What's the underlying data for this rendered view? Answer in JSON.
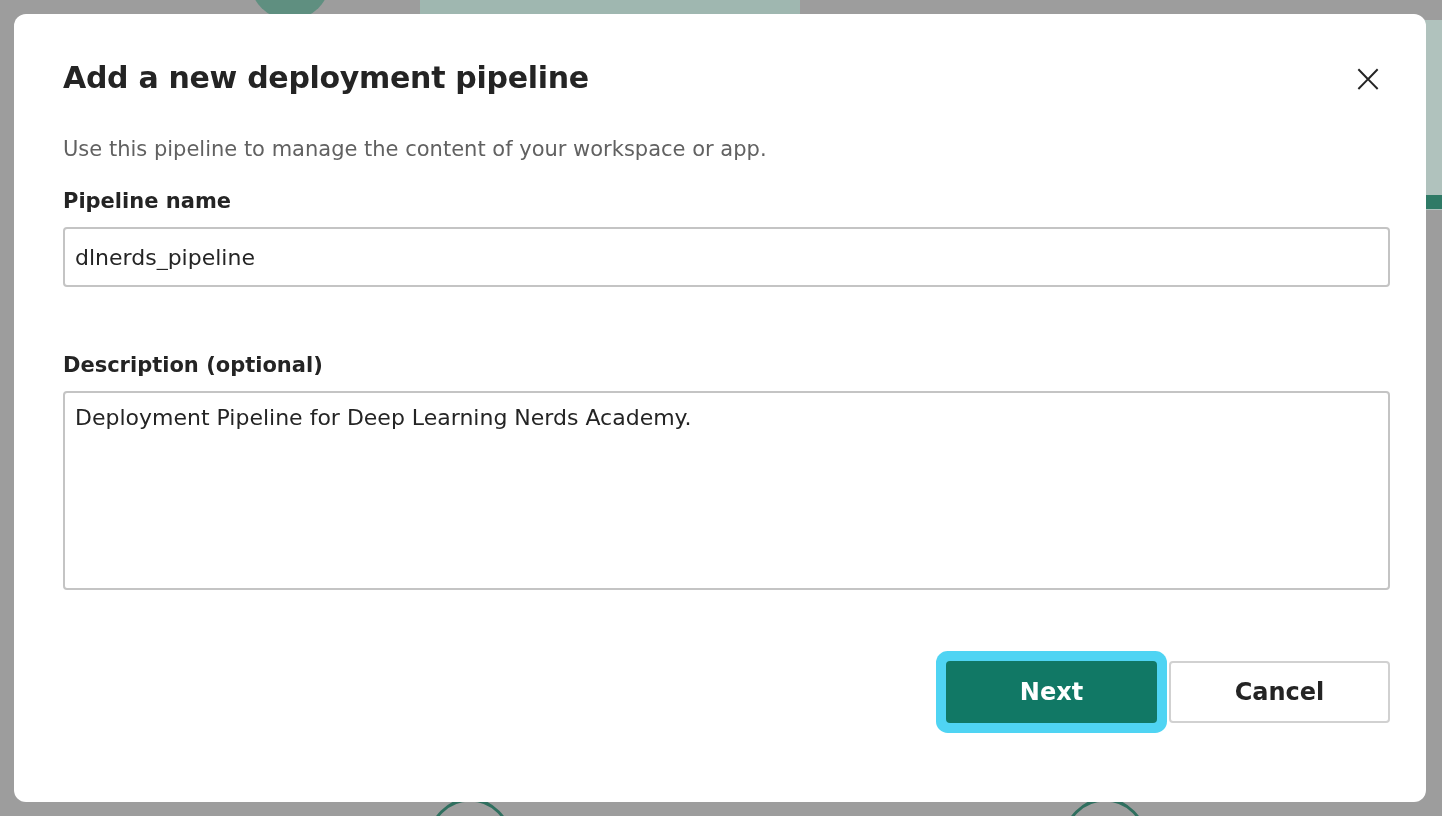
{
  "dialog": {
    "title": "Add a new deployment pipeline",
    "close_icon": "×",
    "subtitle": "Use this pipeline to manage the content of your workspace or app.",
    "fields": [
      {
        "kind": "input",
        "label": "Pipeline name",
        "value": "dlnerds_pipeline"
      },
      {
        "kind": "textarea",
        "label": "Description (optional)",
        "value": "Deployment Pipeline for Deep Learning Nerds Academy."
      }
    ],
    "buttons": [
      {
        "label": "Next",
        "kind": "primary",
        "focused": true
      },
      {
        "label": "Cancel",
        "kind": "secondary",
        "focused": false
      }
    ]
  }
}
